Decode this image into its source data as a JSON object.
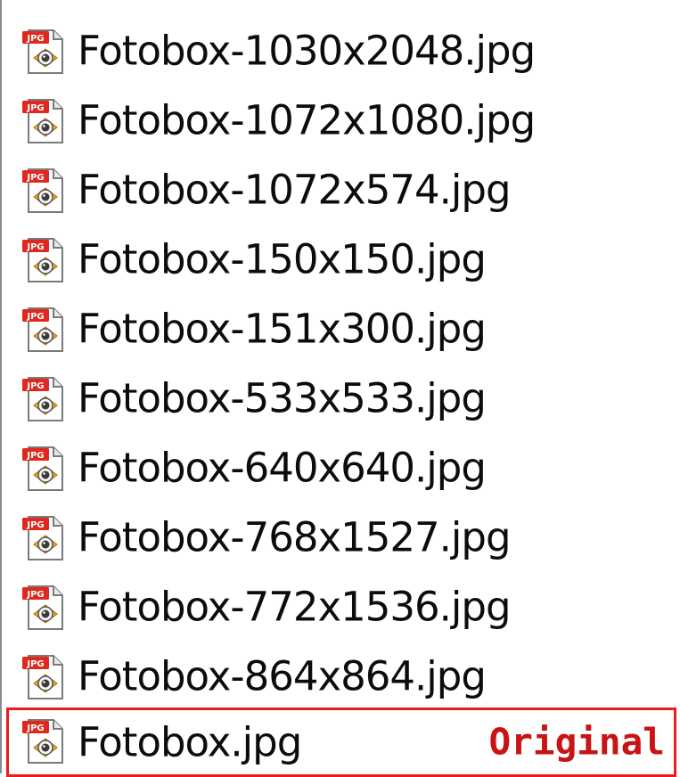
{
  "files": [
    {
      "name": "Fotobox-1030x2048.jpg",
      "icon": "jpg-file-icon",
      "icon_badge": "JPG"
    },
    {
      "name": "Fotobox-1072x1080.jpg",
      "icon": "jpg-file-icon",
      "icon_badge": "JPG"
    },
    {
      "name": "Fotobox-1072x574.jpg",
      "icon": "jpg-file-icon",
      "icon_badge": "JPG"
    },
    {
      "name": "Fotobox-150x150.jpg",
      "icon": "jpg-file-icon",
      "icon_badge": "JPG"
    },
    {
      "name": "Fotobox-151x300.jpg",
      "icon": "jpg-file-icon",
      "icon_badge": "JPG"
    },
    {
      "name": "Fotobox-533x533.jpg",
      "icon": "jpg-file-icon",
      "icon_badge": "JPG"
    },
    {
      "name": "Fotobox-640x640.jpg",
      "icon": "jpg-file-icon",
      "icon_badge": "JPG"
    },
    {
      "name": "Fotobox-768x1527.jpg",
      "icon": "jpg-file-icon",
      "icon_badge": "JPG"
    },
    {
      "name": "Fotobox-772x1536.jpg",
      "icon": "jpg-file-icon",
      "icon_badge": "JPG"
    },
    {
      "name": "Fotobox-864x864.jpg",
      "icon": "jpg-file-icon",
      "icon_badge": "JPG"
    },
    {
      "name": "Fotobox.jpg",
      "icon": "jpg-file-icon",
      "icon_badge": "JPG",
      "annotation": "Original",
      "highlighted": true
    }
  ],
  "colors": {
    "highlight_border": "#ee1c1c",
    "annotation_text": "#c81414",
    "file_name_text": "#0c0c0c",
    "icon_badge": "#e0281e",
    "icon_lens": "#f0a818"
  }
}
